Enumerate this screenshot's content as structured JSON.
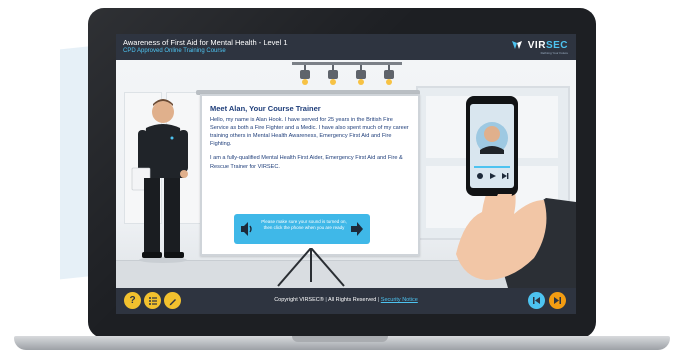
{
  "course": {
    "title": "Awareness of First Aid for Mental Health - Level 1",
    "subtitle": "CPD Approved Online Training Course"
  },
  "brand": {
    "name_prefix": "VIR",
    "name_suffix": "SEC",
    "tagline": "Defining Your Future",
    "accent_color": "#4dc3f0",
    "bar_color": "#2e3440"
  },
  "board": {
    "heading": "Meet Alan, Your Course Trainer",
    "paragraph_1": "Hello, my name is Alan Hook. I have served for 25 years in the British Fire Service as both a Fire Fighter and a Medic. I have also spent much of my career training others in Mental Health Awareness, Emergency First Aid and Fire Fighting.",
    "paragraph_2": "I am a fully-qualified Mental Health First Aider, Emergency First Aid and Fire & Rescue Trainer for VIRSEC."
  },
  "notice": {
    "text": "Please make sure your sound is turned on, then click the phone when you are ready",
    "left_icon": "speaker-icon",
    "right_icon": "arrow-right-icon"
  },
  "footer": {
    "copyright": "Copyright VIRSEC®",
    "separator": "|",
    "rights": "All Rights Reserved",
    "security_link": "Security Notice",
    "left_buttons": [
      "help-icon",
      "menu-list-icon",
      "notes-icon"
    ],
    "right_buttons": [
      "skip-back-icon",
      "skip-forward-icon"
    ]
  }
}
